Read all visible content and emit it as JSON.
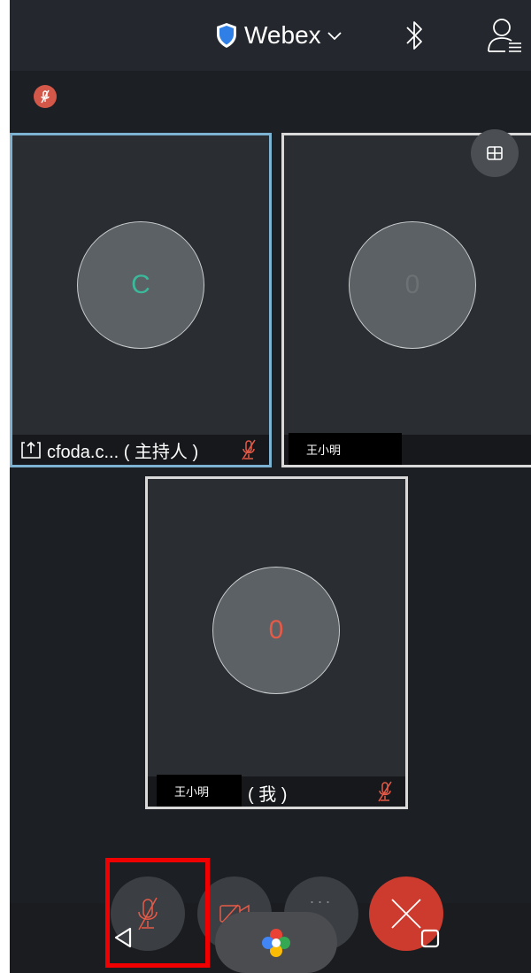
{
  "header": {
    "app_title": "Webex",
    "icons": [
      "shield-icon",
      "chevron-down-icon",
      "bluetooth-icon",
      "participants-icon"
    ]
  },
  "participants": {
    "host": {
      "initial": "C",
      "name_label": "cfoda.c... ( 主持人 )",
      "muted": true,
      "sharing": true
    },
    "p2": {
      "initial": "0",
      "name_label": "王小明"
    },
    "me": {
      "initial": "0",
      "name_label": "王小明",
      "self_tag": "( 我 )",
      "muted": true
    }
  },
  "toolbar": {
    "buttons": [
      "mute-button",
      "video-button",
      "more-button",
      "assistant-button",
      "end-call-button"
    ],
    "more_label": "···"
  },
  "colors": {
    "accent_blue": "#7db2d2",
    "mute_red": "#e65a48",
    "end_call_red": "#cc3b2d",
    "host_initial_green": "#3bb99b",
    "highlight_red": "#f00000"
  }
}
